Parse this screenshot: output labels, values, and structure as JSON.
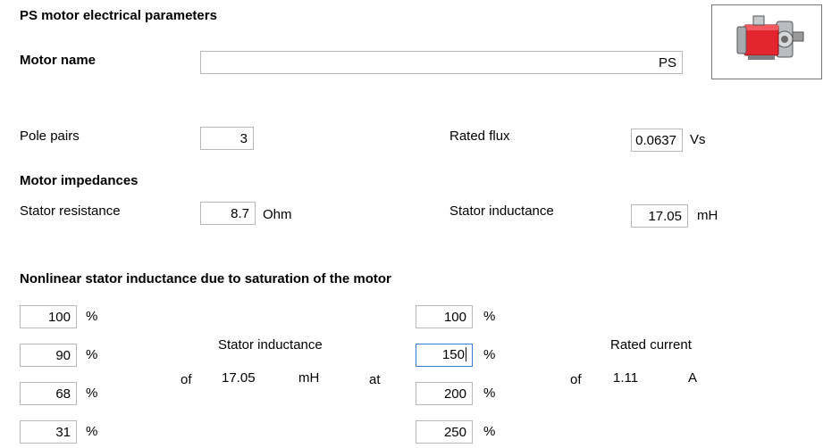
{
  "header": {
    "title": "PS motor electrical parameters"
  },
  "motor_name": {
    "label": "Motor name",
    "value": "PS"
  },
  "pole_pairs": {
    "label": "Pole pairs",
    "value": "3"
  },
  "rated_flux": {
    "label": "Rated flux",
    "value": "0.0637",
    "unit": "Vs"
  },
  "impedances": {
    "title": "Motor impedances",
    "stator_resistance": {
      "label": "Stator resistance",
      "value": "8.7",
      "unit": "Ohm"
    },
    "stator_inductance": {
      "label": "Stator inductance",
      "value": "17.05",
      "unit": "mH"
    }
  },
  "nonlinear": {
    "title": "Nonlinear stator inductance due to saturation of the motor",
    "inductance_percents": [
      "100",
      "90",
      "68",
      "31"
    ],
    "current_percents": [
      "100",
      "150",
      "200",
      "250"
    ],
    "percent_unit": "%",
    "stator_inductance_label": "Stator inductance",
    "of_label": "of",
    "inductance_value": "17.05",
    "inductance_unit": "mH",
    "at_label": "at",
    "rated_current_label": "Rated current",
    "current_of_label": "of",
    "rated_current_value": "1.11",
    "current_unit": "A"
  },
  "icons": {
    "motor": "motor-icon"
  },
  "colors": {
    "motor_red": "#e3262d",
    "field_border": "#b7b7b7",
    "focus_border": "#3a7bd5"
  }
}
